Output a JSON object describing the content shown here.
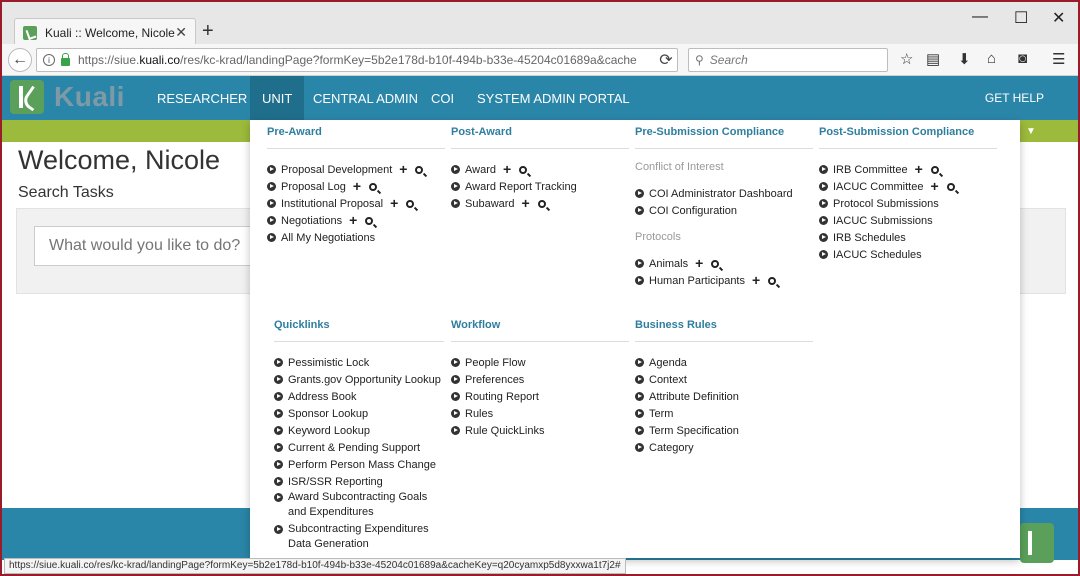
{
  "browser": {
    "tab_title": "Kuali :: Welcome, Nicole",
    "tab_close": "✕",
    "new_tab": "+",
    "url_prefix": "https://siue.",
    "url_host": "kuali.co",
    "url_rest": "/res/kc-krad/landingPage?formKey=5b2e178d-b10f-494b-b33e-45204c01689a&cache",
    "search_placeholder": "Search",
    "window_controls": {
      "minimize": "—",
      "maximize": "☐",
      "close": "✕"
    }
  },
  "header": {
    "logo_text": "Kuali",
    "menu": [
      "RESEARCHER",
      "UNIT",
      "CENTRAL ADMIN",
      "COI",
      "SYSTEM ADMIN PORTAL"
    ],
    "active_menu": "UNIT",
    "help": "GET HELP"
  },
  "page": {
    "welcome": "Welcome, Nicole",
    "search_tasks": "Search Tasks",
    "task_placeholder": "What would you like to do?"
  },
  "mega_menu": {
    "pre_award": {
      "title": "Pre-Award",
      "items": [
        "Proposal Development",
        "Proposal Log",
        "Institutional Proposal",
        "Negotiations",
        "All My Negotiations"
      ]
    },
    "post_award": {
      "title": "Post-Award",
      "items": [
        "Award",
        "Award Report Tracking",
        "Subaward"
      ]
    },
    "pre_submission": {
      "title": "Pre-Submission Compliance",
      "coi_label": "Conflict of Interest",
      "coi_items": [
        "COI Administrator Dashboard",
        "COI Configuration"
      ],
      "protocols_label": "Protocols",
      "protocol_items": [
        "Animals",
        "Human Participants"
      ]
    },
    "post_submission": {
      "title": "Post-Submission Compliance",
      "items": [
        "IRB Committee",
        "IACUC Committee",
        "Protocol Submissions",
        "IACUC Submissions",
        "IRB Schedules",
        "IACUC Schedules"
      ]
    },
    "quicklinks": {
      "title": "Quicklinks",
      "items": [
        "Pessimistic Lock",
        "Grants.gov Opportunity Lookup",
        "Address Book",
        "Sponsor Lookup",
        "Keyword Lookup",
        "Current & Pending Support",
        "Perform Person Mass Change",
        "ISR/SSR Reporting",
        "Award Subcontracting Goals and Expenditures",
        "Subcontracting Expenditures Data Generation"
      ]
    },
    "workflow": {
      "title": "Workflow",
      "items": [
        "People Flow",
        "Preferences",
        "Routing Report",
        "Rules",
        "Rule QuickLinks"
      ]
    },
    "business_rules": {
      "title": "Business Rules",
      "items": [
        "Agenda",
        "Context",
        "Attribute Definition",
        "Term",
        "Term Specification",
        "Category"
      ]
    }
  },
  "status_bar": "https://siue.kuali.co/res/kc-krad/landingPage?formKey=5b2e178d-b10f-494b-b33e-45204c01689a&cacheKey=q20cyamxp5d8yxxwa1t7j2#",
  "colors": {
    "header": "#2a86a8",
    "active": "#1f6f8c",
    "accent_green": "#9cba3c",
    "link": "#2e7ea0"
  }
}
